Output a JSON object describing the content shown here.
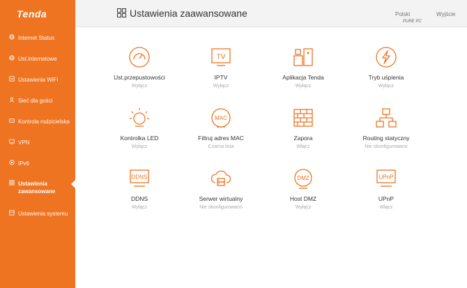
{
  "brand": "Tenda",
  "watermark": "PURE PC",
  "header": {
    "title": "Ustawienia zaawansowane",
    "language": "Polski",
    "logout": "Wyjście"
  },
  "sidebar": {
    "items": [
      {
        "label": "Internet Status",
        "icon": "globe-icon"
      },
      {
        "label": "Ust.internetowe",
        "icon": "globe-icon"
      },
      {
        "label": "Ustawienia WiFi",
        "icon": "wifi-icon"
      },
      {
        "label": "Sieć dla gości",
        "icon": "guest-icon"
      },
      {
        "label": "Kontrola rodzicielska",
        "icon": "parental-icon"
      },
      {
        "label": "VPN",
        "icon": "vpn-icon"
      },
      {
        "label": "IPv6",
        "icon": "ipv6-icon"
      },
      {
        "label": "Ustawienia zawansowane",
        "icon": "grid-icon",
        "active": true
      },
      {
        "label": "Ustawienia systemu",
        "icon": "system-icon"
      }
    ]
  },
  "tiles": [
    {
      "name": "Ust.przepustowości",
      "status": "Wyłącz",
      "icon": "speedometer-icon"
    },
    {
      "name": "IPTV",
      "status": "Wyłącz",
      "icon": "tv-icon"
    },
    {
      "name": "Aplikacja Tenda",
      "status": "Wyłącz",
      "icon": "app-icon"
    },
    {
      "name": "Tryb uśpienia",
      "status": "Wyłącz",
      "icon": "sleep-icon"
    },
    {
      "name": "Kontrolka LED",
      "status": "Wyłącz",
      "icon": "led-icon"
    },
    {
      "name": "Filtruj adres MAC",
      "status": "Czarna lista",
      "icon": "mac-filter-icon"
    },
    {
      "name": "Zapora",
      "status": "Włącz",
      "icon": "firewall-icon"
    },
    {
      "name": "Routing statyczny",
      "status": "Nie skonfigurowano",
      "icon": "routing-icon"
    },
    {
      "name": "DDNS",
      "status": "Wyłącz",
      "icon": "ddns-icon"
    },
    {
      "name": "Serwer wirtualny",
      "status": "Nie skonfigurowano",
      "icon": "virtual-server-icon"
    },
    {
      "name": "Host DMZ",
      "status": "Wyłącz",
      "icon": "dmz-icon"
    },
    {
      "name": "UPnP",
      "status": "Włącz",
      "icon": "upnp-icon"
    }
  ],
  "icon_text": {
    "tv": "TV",
    "mac": "MAC",
    "ddns": "DDNS",
    "dmz": "DMZ",
    "upnp": "UPnP"
  },
  "colors": {
    "accent": "#ef7421",
    "sidebar_bg": "#ef7421",
    "topbar_bg": "#f3f3f3"
  }
}
